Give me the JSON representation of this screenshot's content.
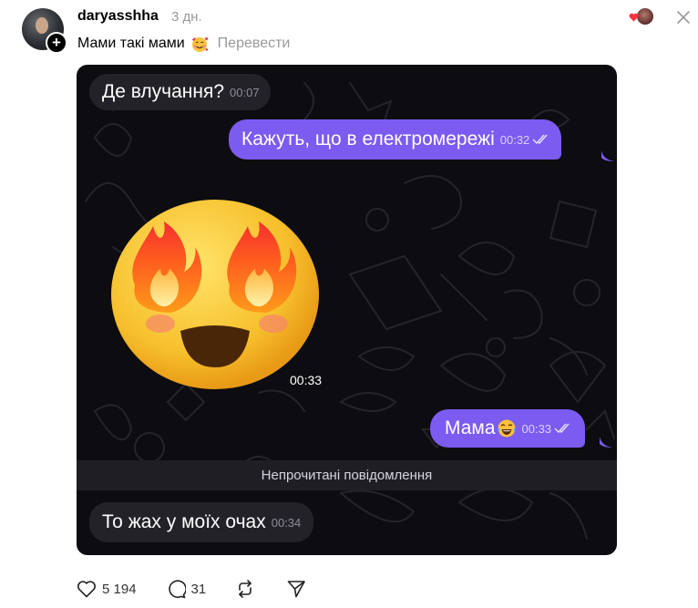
{
  "post": {
    "username": "daryasshha",
    "time_ago": "3 дн.",
    "caption": "Мами такі мами",
    "caption_emoji": "smiling-face-with-hearts",
    "translate_label": "Перевести"
  },
  "chat": {
    "messages": [
      {
        "direction": "in",
        "text": "Де влучання?",
        "time": "00:07"
      },
      {
        "direction": "out",
        "text": "Кажуть, що в електромережі",
        "time": "00:32",
        "read": true
      },
      {
        "direction": "in",
        "sticker": "face-with-fire-eyes",
        "time": "00:33"
      },
      {
        "direction": "out",
        "text": "Мама",
        "emoji": "tears-of-joy",
        "time": "00:33",
        "read": true
      },
      {
        "direction": "in",
        "text": "То жах у моїх очах",
        "time": "00:34"
      }
    ],
    "unread_divider": "Непрочитані повідомлення"
  },
  "actions": {
    "likes": "5 194",
    "comments": "31"
  },
  "colors": {
    "outgoing_bubble": "#7b5bf0",
    "incoming_bubble": "#242229",
    "chat_background": "#0d0c11",
    "secondary_text": "#999999"
  },
  "icons": [
    "plus-icon",
    "heart-icon",
    "more-icon",
    "like-icon",
    "comment-icon",
    "repost-icon",
    "share-icon",
    "double-check-icon"
  ]
}
